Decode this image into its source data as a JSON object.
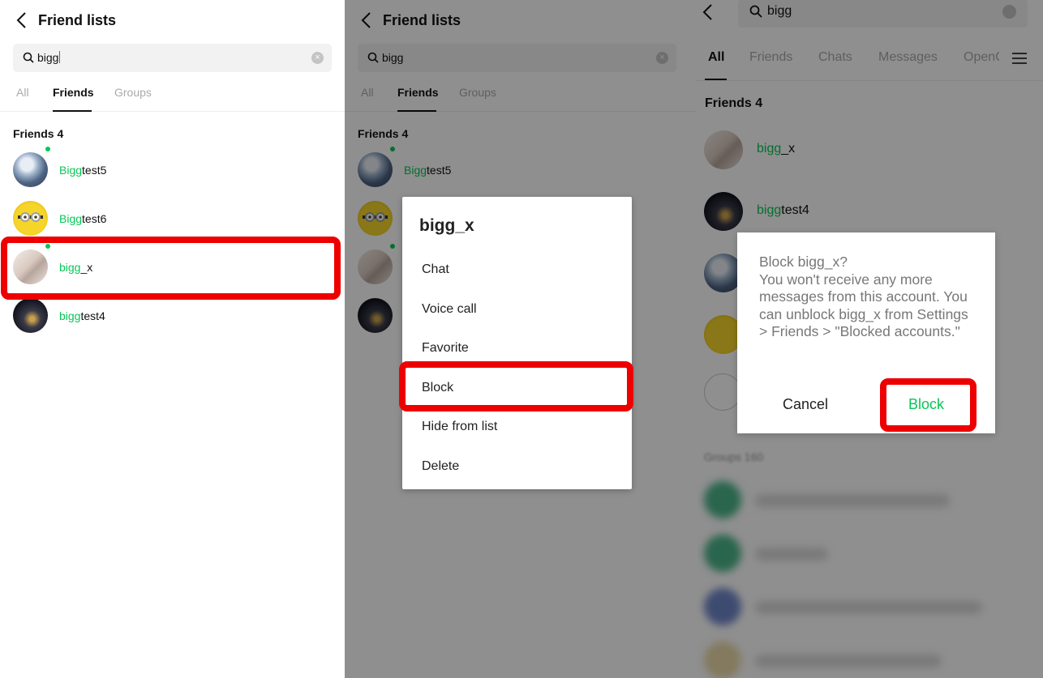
{
  "panel1": {
    "header_title": "Friend lists",
    "search_value": "bigg",
    "tabs": [
      "All",
      "Friends",
      "Groups"
    ],
    "section_title": "Friends 4",
    "friends": [
      {
        "highlight": "Bigg",
        "rest": "test5"
      },
      {
        "highlight": "Bigg",
        "rest": "test6"
      },
      {
        "highlight": "bigg",
        "rest": "_x"
      },
      {
        "highlight": "bigg",
        "rest": "test4"
      }
    ]
  },
  "panel2": {
    "header_title": "Friend lists",
    "search_value": "bigg",
    "tabs": [
      "All",
      "Friends",
      "Groups"
    ],
    "section_title": "Friends 4",
    "first_friend": {
      "highlight": "Bigg",
      "rest": "test5"
    },
    "menu": {
      "title": "bigg_x",
      "items": [
        "Chat",
        "Voice call",
        "Favorite",
        "Block",
        "Hide from list",
        "Delete"
      ]
    }
  },
  "panel3": {
    "search_value": "bigg",
    "tabs": [
      "All",
      "Friends",
      "Chats",
      "Messages",
      "OpenC"
    ],
    "section_title": "Friends 4",
    "friends": [
      {
        "highlight": "bigg",
        "rest": "_x"
      },
      {
        "highlight": "bigg",
        "rest": "test4"
      }
    ],
    "groups_label": "Groups 160",
    "dialog": {
      "message": "Block bigg_x?\nYou won't receive any more messages from this account. You can unblock bigg_x from Settings > Friends > \"Blocked accounts.\"",
      "cancel_label": "Cancel",
      "block_label": "Block"
    }
  },
  "colors": {
    "accent_green": "#06c755",
    "highlight_red": "#ee0000",
    "overlay": "rgba(0,0,0,0.44)"
  }
}
